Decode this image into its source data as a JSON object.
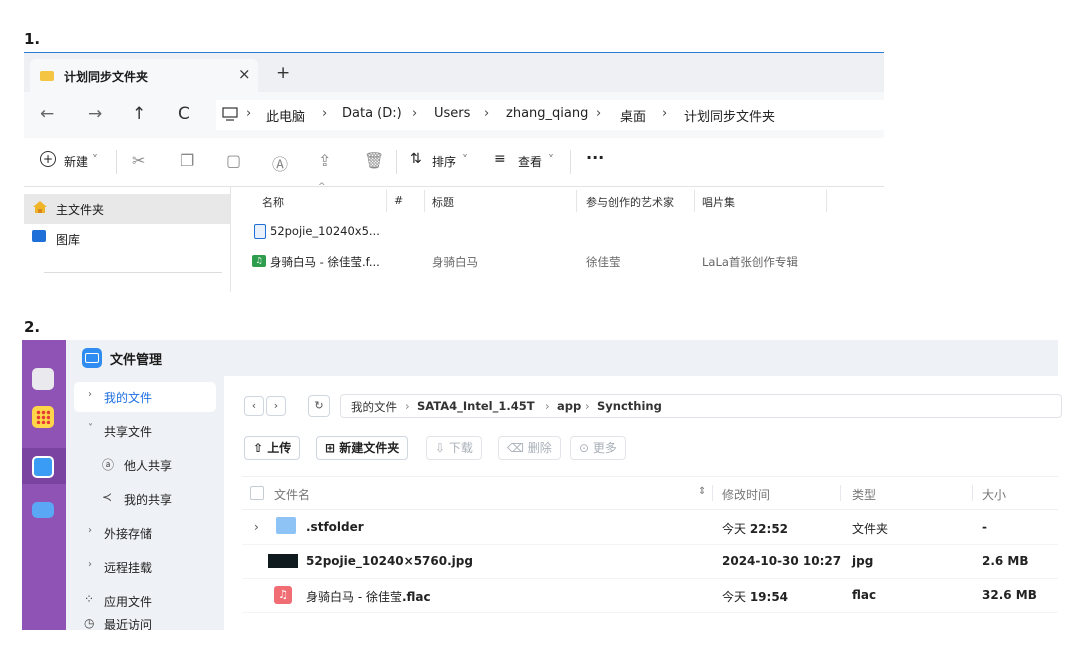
{
  "labels": {
    "one": "1.",
    "two": "2."
  },
  "explorer": {
    "tab_title": "计划同步文件夹",
    "tab_close": "×",
    "tab_new": "+",
    "nav": {
      "back": "←",
      "forward": "→",
      "up": "↑",
      "refresh": "C"
    },
    "address": [
      "此电脑",
      "Data (D:)",
      "Users",
      "zhang_qiang",
      "桌面",
      "计划同步文件夹"
    ],
    "address_sep": "›",
    "toolbar": {
      "new_label": "新建",
      "sort_label": "排序",
      "view_label": "查看",
      "more_label": "···",
      "caret": "˅"
    },
    "leftnav": [
      {
        "label": "主文件夹",
        "selected": true,
        "icon": "home-icon"
      },
      {
        "label": "图库",
        "selected": false,
        "icon": "gallery-icon"
      }
    ],
    "columns": {
      "name": "名称",
      "num": "#",
      "title": "标题",
      "artist": "参与创作的艺术家",
      "album": "唱片集"
    },
    "files": [
      {
        "name": "52pojie_10240x5...",
        "title": "",
        "artist": "",
        "album": "",
        "icon": "image-file-icon"
      },
      {
        "name": "身骑白马 - 徐佳莹.f...",
        "title": "身骑白马",
        "artist": "徐佳莹",
        "album": "LaLa首张创作专辑",
        "icon": "audio-file-icon"
      }
    ]
  },
  "nas": {
    "app_title": "文件管理",
    "sidebar": [
      {
        "label": "我的文件",
        "arrow": "›",
        "selected": true
      },
      {
        "label": "共享文件",
        "arrow": "˅",
        "selected": false
      },
      {
        "label": "他人共享",
        "arrow": "",
        "selected": false,
        "icon": "people-icon"
      },
      {
        "label": "我的共享",
        "arrow": "",
        "selected": false,
        "icon": "share-icon"
      },
      {
        "label": "外接存储",
        "arrow": "›",
        "selected": false
      },
      {
        "label": "远程挂载",
        "arrow": "›",
        "selected": false
      },
      {
        "label": "应用文件",
        "arrow": "",
        "selected": false,
        "icon": "apps-icon"
      },
      {
        "label": "最近访问",
        "arrow": "",
        "selected": false,
        "icon": "clock-icon"
      }
    ],
    "nav": {
      "back": "‹",
      "forward": "›",
      "refresh": "↻"
    },
    "path": [
      "我的文件",
      "SATA4_Intel_1.45T",
      "app",
      "Syncthing"
    ],
    "path_sep": "›",
    "actions": {
      "upload": "上传",
      "new_folder": "新建文件夹",
      "download": "下载",
      "delete": "删除",
      "more": "更多"
    },
    "columns": {
      "name": "文件名",
      "mtime": "修改时间",
      "type": "类型",
      "size": "大小"
    },
    "rows": [
      {
        "name": ".stfolder",
        "mtime_prefix": "今天 ",
        "mtime": "22:52",
        "type": "文件夹",
        "size": "-",
        "icon": "folder-icon",
        "expander": "›"
      },
      {
        "name": "52pojie_10240×5760.jpg",
        "mtime_prefix": "",
        "mtime": "2024-10-30 10:27",
        "type": "jpg",
        "size": "2.6 MB",
        "icon": "image-thumb-icon",
        "expander": ""
      },
      {
        "name_prefix": "身骑白马 - 徐佳莹",
        "name": ".flac",
        "mtime_prefix": "今天 ",
        "mtime": "19:54",
        "type": "flac",
        "size": "32.6 MB",
        "icon": "music-file-icon",
        "expander": ""
      }
    ]
  }
}
